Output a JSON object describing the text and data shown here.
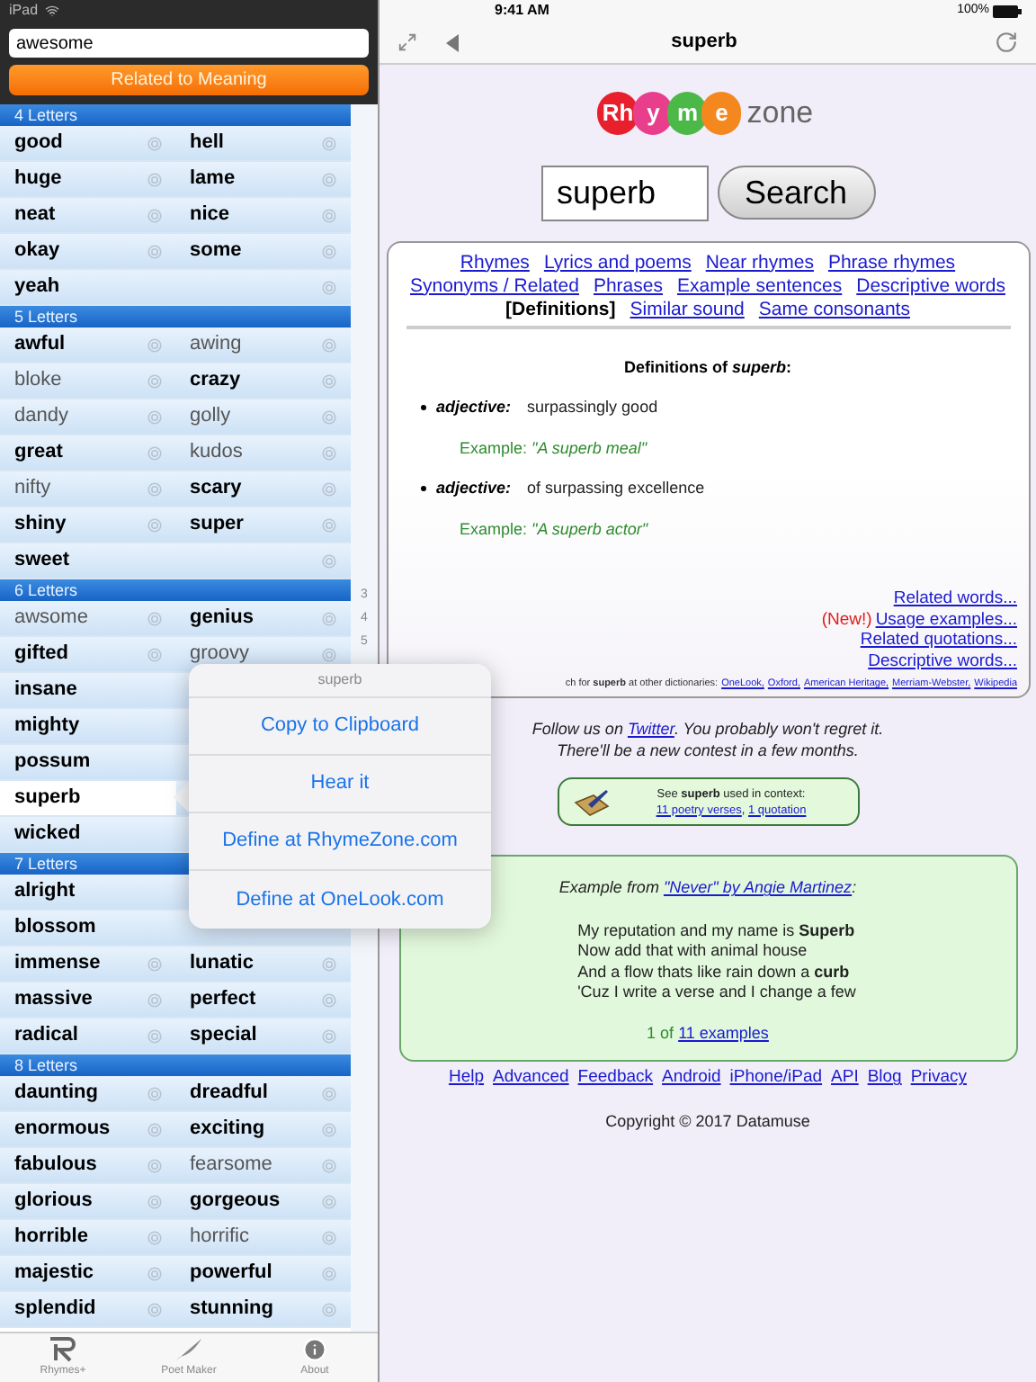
{
  "status_bar": {
    "device": "iPad",
    "time": "9:41 AM",
    "battery": "100%"
  },
  "sidebar": {
    "search": {
      "value": "awesome"
    },
    "mode_button": "Related to Meaning",
    "sections": [
      {
        "title": "4 Letters",
        "rows": [
          [
            {
              "word": "good",
              "common": true,
              "selected": false
            },
            {
              "word": "hell",
              "common": true,
              "selected": false
            }
          ],
          [
            {
              "word": "huge",
              "common": true,
              "selected": false
            },
            {
              "word": "lame",
              "common": true,
              "selected": false
            }
          ],
          [
            {
              "word": "neat",
              "common": true,
              "selected": false
            },
            {
              "word": "nice",
              "common": true,
              "selected": false
            }
          ],
          [
            {
              "word": "okay",
              "common": true,
              "selected": false
            },
            {
              "word": "some",
              "common": true,
              "selected": false
            }
          ],
          [
            {
              "word": "yeah",
              "common": true,
              "selected": false
            }
          ]
        ]
      },
      {
        "title": "5 Letters",
        "rows": [
          [
            {
              "word": "awful",
              "common": true,
              "selected": false
            },
            {
              "word": "awing",
              "common": false,
              "selected": false
            }
          ],
          [
            {
              "word": "bloke",
              "common": false,
              "selected": false
            },
            {
              "word": "crazy",
              "common": true,
              "selected": false
            }
          ],
          [
            {
              "word": "dandy",
              "common": false,
              "selected": false
            },
            {
              "word": "golly",
              "common": false,
              "selected": false
            }
          ],
          [
            {
              "word": "great",
              "common": true,
              "selected": false
            },
            {
              "word": "kudos",
              "common": false,
              "selected": false
            }
          ],
          [
            {
              "word": "nifty",
              "common": false,
              "selected": false
            },
            {
              "word": "scary",
              "common": true,
              "selected": false
            }
          ],
          [
            {
              "word": "shiny",
              "common": true,
              "selected": false
            },
            {
              "word": "super",
              "common": true,
              "selected": false
            }
          ],
          [
            {
              "word": "sweet",
              "common": true,
              "selected": false
            }
          ]
        ]
      },
      {
        "title": "6 Letters",
        "rows": [
          [
            {
              "word": "awsome",
              "common": false,
              "selected": false
            },
            {
              "word": "genius",
              "common": true,
              "selected": false
            }
          ],
          [
            {
              "word": "gifted",
              "common": true,
              "selected": false
            },
            {
              "word": "groovy",
              "common": false,
              "selected": false
            }
          ],
          [
            {
              "word": "insane",
              "common": true,
              "selected": false
            }
          ],
          [
            {
              "word": "mighty",
              "common": true,
              "selected": false
            }
          ],
          [
            {
              "word": "possum",
              "common": true,
              "selected": false
            }
          ],
          [
            {
              "word": "superb",
              "common": true,
              "selected": true
            }
          ],
          [
            {
              "word": "wicked",
              "common": true,
              "selected": false
            }
          ]
        ]
      },
      {
        "title": "7 Letters",
        "rows": [
          [
            {
              "word": "alright",
              "common": true,
              "selected": false
            }
          ],
          [
            {
              "word": "blossom",
              "common": true,
              "selected": false
            }
          ],
          [
            {
              "word": "immense",
              "common": true,
              "selected": false
            },
            {
              "word": "lunatic",
              "common": true,
              "selected": false
            }
          ],
          [
            {
              "word": "massive",
              "common": true,
              "selected": false
            },
            {
              "word": "perfect",
              "common": true,
              "selected": false
            }
          ],
          [
            {
              "word": "radical",
              "common": true,
              "selected": false
            },
            {
              "word": "special",
              "common": true,
              "selected": false
            }
          ]
        ]
      },
      {
        "title": "8 Letters",
        "rows": [
          [
            {
              "word": "daunting",
              "common": true,
              "selected": false
            },
            {
              "word": "dreadful",
              "common": true,
              "selected": false
            }
          ],
          [
            {
              "word": "enormous",
              "common": true,
              "selected": false
            },
            {
              "word": "exciting",
              "common": true,
              "selected": false
            }
          ],
          [
            {
              "word": "fabulous",
              "common": true,
              "selected": false
            },
            {
              "word": "fearsome",
              "common": false,
              "selected": false
            }
          ],
          [
            {
              "word": "glorious",
              "common": true,
              "selected": false
            },
            {
              "word": "gorgeous",
              "common": true,
              "selected": false
            }
          ],
          [
            {
              "word": "horrible",
              "common": true,
              "selected": false
            },
            {
              "word": "horrific",
              "common": false,
              "selected": false
            }
          ],
          [
            {
              "word": "majestic",
              "common": true,
              "selected": false
            },
            {
              "word": "powerful",
              "common": true,
              "selected": false
            }
          ],
          [
            {
              "word": "splendid",
              "common": true,
              "selected": false
            },
            {
              "word": "stunning",
              "common": true,
              "selected": false
            }
          ]
        ]
      }
    ],
    "index": [
      "3",
      "4",
      "5"
    ],
    "popover": {
      "title": "superb",
      "actions": [
        "Copy to Clipboard",
        "Hear it",
        "Define at RhymeZone.com",
        "Define at OneLook.com"
      ]
    },
    "tab_bar": [
      {
        "kind": "rhymes",
        "label": "Rhymes+"
      },
      {
        "kind": "poet",
        "label": "Poet Maker"
      },
      {
        "kind": "about",
        "label": "About"
      }
    ]
  },
  "browser": {
    "title": "superb",
    "logo": {
      "bubbles": [
        {
          "text": "Rh",
          "color": "#e8202e"
        },
        {
          "text": "y",
          "color": "#e83e8c"
        },
        {
          "text": "m",
          "color": "#4cb848"
        },
        {
          "text": "e",
          "color": "#f5871f"
        }
      ],
      "suffix": "zone"
    },
    "search": {
      "value": "superb",
      "button": "Search"
    },
    "nav_links": [
      [
        {
          "label": "Rhymes",
          "selected": false
        },
        {
          "label": "Lyrics and poems",
          "selected": false
        },
        {
          "label": "Near rhymes",
          "selected": false
        },
        {
          "label": "Phrase rhymes",
          "selected": false
        }
      ],
      [
        {
          "label": "Synonyms / Related",
          "selected": false
        },
        {
          "label": "Phrases",
          "selected": false
        },
        {
          "label": "Example sentences",
          "selected": false
        },
        {
          "label": "Descriptive words",
          "selected": false
        }
      ],
      [
        {
          "label": "[Definitions]",
          "selected": true
        },
        {
          "label": "Similar sound",
          "selected": false
        },
        {
          "label": "Same consonants",
          "selected": false
        }
      ]
    ],
    "definitions": {
      "heading": "Definitions of *superb*:",
      "items": [
        {
          "pos": "adjective:",
          "text": "surpassingly good",
          "example": "Example: *\"A superb meal\"*"
        },
        {
          "pos": "adjective:",
          "text": "of surpassing excellence",
          "example": "Example: *\"A superb actor\"*"
        }
      ]
    },
    "more_links": [
      {
        "label": "Related words..."
      },
      {
        "note": "(New!)",
        "label": "Usage examples..."
      },
      {
        "label": "Related quotations..."
      },
      {
        "label": "Descriptive words..."
      }
    ],
    "dictionaries": {
      "text": "ch for **superb** at other dictionaries:",
      "links": [
        "OneLook,",
        "Oxford,",
        "American Heritage,",
        "Merriam-Webster,",
        "Wikipedia"
      ]
    },
    "follow": {
      "before": "Follow us on ",
      "link": "Twitter",
      "after": ". You probably won't regret it.",
      "line2": "There'll be a new contest in a few months."
    },
    "context": {
      "text": "See **superb** used in context:",
      "links": [
        {
          "label": "11 poetry verses",
          "after": ","
        },
        {
          "label": "1 quotation"
        }
      ]
    },
    "example": {
      "before": "Example from ",
      "link": "\"Never\" by Angie Martinez",
      "after": ":",
      "lines": [
        "My reputation and my name is **Superb**",
        "Now add that with animal house",
        "And a flow thats like rain down a **curb**",
        "'Cuz I write a verse and I change a few"
      ],
      "count": "1 of ",
      "count_link": "11 examples"
    },
    "footer_links": [
      "Help",
      "Advanced",
      "Feedback",
      "Android",
      "iPhone/iPad",
      "API",
      "Blog",
      "Privacy"
    ],
    "copyright": "Copyright © 2017 Datamuse"
  }
}
